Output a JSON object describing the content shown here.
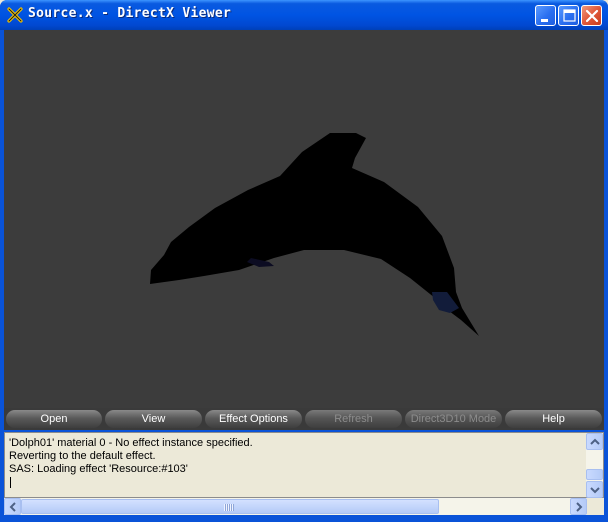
{
  "window": {
    "title": "Source.x - DirectX Viewer",
    "colors": {
      "titlebar": "#0054e3",
      "viewport_bg": "#3c3c3c",
      "model": "#000000"
    }
  },
  "caption_buttons": {
    "minimize_icon": "minimize-icon",
    "maximize_icon": "maximize-icon",
    "close_icon": "close-icon"
  },
  "viewport": {
    "model_icon": "dolphin-model"
  },
  "toolbar": {
    "buttons": [
      {
        "label": "Open",
        "enabled": true
      },
      {
        "label": "View",
        "enabled": true
      },
      {
        "label": "Effect Options",
        "enabled": true
      },
      {
        "label": "Refresh",
        "enabled": false
      },
      {
        "label": "Direct3D10 Mode",
        "enabled": false
      },
      {
        "label": "Help",
        "enabled": true
      }
    ]
  },
  "log": {
    "lines": [
      "'Dolph01' material 0 - No effect instance specified.",
      "Reverting to the default effect.",
      "SAS: Loading effect 'Resource:#103'"
    ]
  }
}
